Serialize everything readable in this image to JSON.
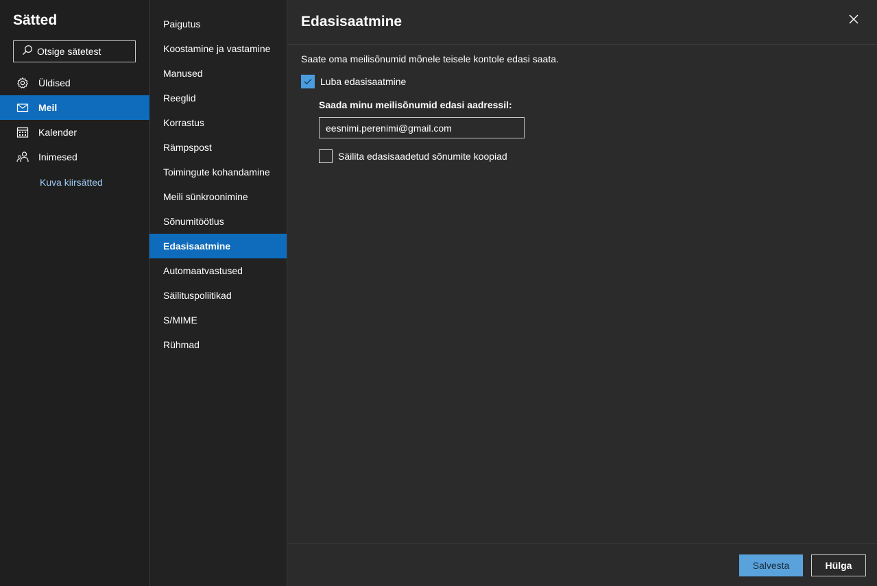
{
  "sidebar": {
    "title": "Sätted",
    "search": {
      "placeholder": "Otsige sätetest",
      "icon": "search-icon"
    },
    "items": [
      {
        "label": "Üldised",
        "icon": "gear-icon",
        "active": false
      },
      {
        "label": "Meil",
        "icon": "mail-icon",
        "active": true
      },
      {
        "label": "Kalender",
        "icon": "calendar-icon",
        "active": false
      },
      {
        "label": "Inimesed",
        "icon": "people-icon",
        "active": false
      }
    ],
    "quick_settings_label": "Kuva kiirsätted"
  },
  "categories": {
    "items": [
      {
        "label": "Paigutus",
        "active": false
      },
      {
        "label": "Koostamine ja vastamine",
        "active": false
      },
      {
        "label": "Manused",
        "active": false
      },
      {
        "label": "Reeglid",
        "active": false
      },
      {
        "label": "Korrastus",
        "active": false
      },
      {
        "label": "Rämpspost",
        "active": false
      },
      {
        "label": "Toimingute kohandamine",
        "active": false
      },
      {
        "label": "Meili sünkroonimine",
        "active": false
      },
      {
        "label": "Sõnumitöötlus",
        "active": false
      },
      {
        "label": "Edasisaatmine",
        "active": true
      },
      {
        "label": "Automaatvastused",
        "active": false
      },
      {
        "label": "Säilituspoliitikad",
        "active": false
      },
      {
        "label": "S/MIME",
        "active": false
      },
      {
        "label": "Rühmad",
        "active": false
      }
    ]
  },
  "pane": {
    "title": "Edasisaatmine",
    "description": "Saate oma meilisõnumid mõnele teisele kontole edasi saata.",
    "enable_forwarding": {
      "label": "Luba edasisaatmine",
      "checked": true
    },
    "forward_to_label": "Saada minu meilisõnumid edasi aadressil:",
    "forward_to_value": "eesnimi.perenimi@gmail.com",
    "keep_copy": {
      "label": "Säilita edasisaadetud sõnumite koopiad",
      "checked": false
    },
    "save_label": "Salvesta",
    "discard_label": "Hülga"
  },
  "colors": {
    "accent": "#0f6cbd",
    "link": "#9cc8f0",
    "checkbox_checked": "#4a9ee0",
    "save_button": "#5aa2dc"
  }
}
